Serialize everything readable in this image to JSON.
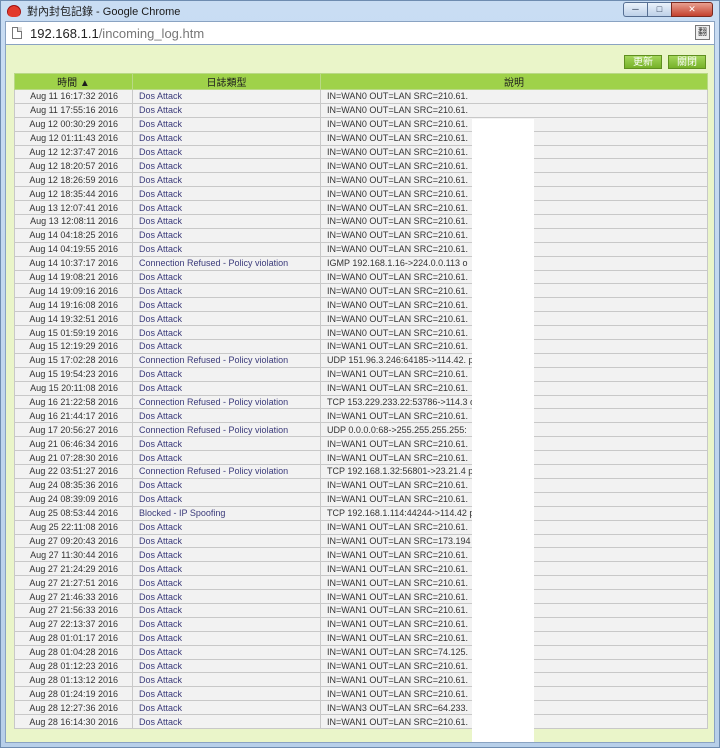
{
  "window": {
    "title": "對內封包記錄 - Google Chrome",
    "min_label": "─",
    "max_label": "□",
    "close_label": "✕"
  },
  "address": {
    "host": "192.168.1.1",
    "path": "/incoming_log.htm",
    "translate_label": "翻"
  },
  "toolbar": {
    "refresh_label": "更新",
    "close_label": "關閉"
  },
  "table": {
    "headers": {
      "time": "時間 ▲",
      "type": "日誌類型",
      "desc": "說明"
    },
    "rows": [
      {
        "time": "Aug 11 16:17:32 2016",
        "type": "Dos Attack",
        "desc": "IN=WAN0 OUT=LAN SRC=210.61."
      },
      {
        "time": "Aug 11 17:55:16 2016",
        "type": "Dos Attack",
        "desc": "IN=WAN0 OUT=LAN SRC=210.61."
      },
      {
        "time": "Aug 12 00:30:29 2016",
        "type": "Dos Attack",
        "desc": "IN=WAN0 OUT=LAN SRC=210.61."
      },
      {
        "time": "Aug 12 01:11:43 2016",
        "type": "Dos Attack",
        "desc": "IN=WAN0 OUT=LAN SRC=210.61."
      },
      {
        "time": "Aug 12 12:37:47 2016",
        "type": "Dos Attack",
        "desc": "IN=WAN0 OUT=LAN SRC=210.61."
      },
      {
        "time": "Aug 12 18:20:57 2016",
        "type": "Dos Attack",
        "desc": "IN=WAN0 OUT=LAN SRC=210.61."
      },
      {
        "time": "Aug 12 18:26:59 2016",
        "type": "Dos Attack",
        "desc": "IN=WAN0 OUT=LAN SRC=210.61."
      },
      {
        "time": "Aug 12 18:35:44 2016",
        "type": "Dos Attack",
        "desc": "IN=WAN0 OUT=LAN SRC=210.61."
      },
      {
        "time": "Aug 13 12:07:41 2016",
        "type": "Dos Attack",
        "desc": "IN=WAN0 OUT=LAN SRC=210.61."
      },
      {
        "time": "Aug 13 12:08:11 2016",
        "type": "Dos Attack",
        "desc": "IN=WAN0 OUT=LAN SRC=210.61."
      },
      {
        "time": "Aug 14 04:18:25 2016",
        "type": "Dos Attack",
        "desc": "IN=WAN0 OUT=LAN SRC=210.61."
      },
      {
        "time": "Aug 14 04:19:55 2016",
        "type": "Dos Attack",
        "desc": "IN=WAN0 OUT=LAN SRC=210.61."
      },
      {
        "time": "Aug 14 10:37:17 2016",
        "type": "Connection Refused - Policy violation",
        "desc": "IGMP 192.168.1.16->224.0.0.113 o"
      },
      {
        "time": "Aug 14 19:08:21 2016",
        "type": "Dos Attack",
        "desc": "IN=WAN0 OUT=LAN SRC=210.61."
      },
      {
        "time": "Aug 14 19:09:16 2016",
        "type": "Dos Attack",
        "desc": "IN=WAN0 OUT=LAN SRC=210.61."
      },
      {
        "time": "Aug 14 19:16:08 2016",
        "type": "Dos Attack",
        "desc": "IN=WAN0 OUT=LAN SRC=210.61."
      },
      {
        "time": "Aug 14 19:32:51 2016",
        "type": "Dos Attack",
        "desc": "IN=WAN0 OUT=LAN SRC=210.61."
      },
      {
        "time": "Aug 15 01:59:19 2016",
        "type": "Dos Attack",
        "desc": "IN=WAN0 OUT=LAN SRC=210.61."
      },
      {
        "time": "Aug 15 12:19:29 2016",
        "type": "Dos Attack",
        "desc": "IN=WAN1 OUT=LAN SRC=210.61."
      },
      {
        "time": "Aug 15 17:02:28 2016",
        "type": "Connection Refused - Policy violation",
        "desc": "UDP 151.96.3.246:64185->114.42.                ppp3"
      },
      {
        "time": "Aug 15 19:54:23 2016",
        "type": "Dos Attack",
        "desc": "IN=WAN1 OUT=LAN SRC=210.61."
      },
      {
        "time": "Aug 15 20:11:08 2016",
        "type": "Dos Attack",
        "desc": "IN=WAN1 OUT=LAN SRC=210.61."
      },
      {
        "time": "Aug 16 21:22:58 2016",
        "type": "Connection Refused - Policy violation",
        "desc": "TCP 153.229.233.22:53786->114.3              on ppp3"
      },
      {
        "time": "Aug 16 21:44:17 2016",
        "type": "Dos Attack",
        "desc": "IN=WAN1 OUT=LAN SRC=210.61."
      },
      {
        "time": "Aug 17 20:56:27 2016",
        "type": "Connection Refused - Policy violation",
        "desc": "UDP 0.0.0.0:68->255.255.255.255:"
      },
      {
        "time": "Aug 21 06:46:34 2016",
        "type": "Dos Attack",
        "desc": "IN=WAN1 OUT=LAN SRC=210.61."
      },
      {
        "time": "Aug 21 07:28:30 2016",
        "type": "Dos Attack",
        "desc": "IN=WAN1 OUT=LAN SRC=210.61."
      },
      {
        "time": "Aug 22 03:51:27 2016",
        "type": "Connection Refused - Policy violation",
        "desc": "TCP 192.168.1.32:56801->23.21.4               p0"
      },
      {
        "time": "Aug 24 08:35:36 2016",
        "type": "Dos Attack",
        "desc": "IN=WAN1 OUT=LAN SRC=210.61."
      },
      {
        "time": "Aug 24 08:39:09 2016",
        "type": "Dos Attack",
        "desc": "IN=WAN1 OUT=LAN SRC=210.61."
      },
      {
        "time": "Aug 25 08:53:44 2016",
        "type": "Blocked - IP Spoofing",
        "desc": "TCP 192.168.1.114:44244->114.42                ppp0"
      },
      {
        "time": "Aug 25 22:11:08 2016",
        "type": "Dos Attack",
        "desc": "IN=WAN1 OUT=LAN SRC=210.61."
      },
      {
        "time": "Aug 27 09:20:43 2016",
        "type": "Dos Attack",
        "desc": "IN=WAN1 OUT=LAN SRC=173.194"
      },
      {
        "time": "Aug 27 11:30:44 2016",
        "type": "Dos Attack",
        "desc": "IN=WAN1 OUT=LAN SRC=210.61."
      },
      {
        "time": "Aug 27 21:24:29 2016",
        "type": "Dos Attack",
        "desc": "IN=WAN1 OUT=LAN SRC=210.61."
      },
      {
        "time": "Aug 27 21:27:51 2016",
        "type": "Dos Attack",
        "desc": "IN=WAN1 OUT=LAN SRC=210.61."
      },
      {
        "time": "Aug 27 21:46:33 2016",
        "type": "Dos Attack",
        "desc": "IN=WAN1 OUT=LAN SRC=210.61."
      },
      {
        "time": "Aug 27 21:56:33 2016",
        "type": "Dos Attack",
        "desc": "IN=WAN1 OUT=LAN SRC=210.61."
      },
      {
        "time": "Aug 27 22:13:37 2016",
        "type": "Dos Attack",
        "desc": "IN=WAN1 OUT=LAN SRC=210.61."
      },
      {
        "time": "Aug 28 01:01:17 2016",
        "type": "Dos Attack",
        "desc": "IN=WAN1 OUT=LAN SRC=210.61."
      },
      {
        "time": "Aug 28 01:04:28 2016",
        "type": "Dos Attack",
        "desc": "IN=WAN1 OUT=LAN SRC=74.125."
      },
      {
        "time": "Aug 28 01:12:23 2016",
        "type": "Dos Attack",
        "desc": "IN=WAN1 OUT=LAN SRC=210.61."
      },
      {
        "time": "Aug 28 01:13:12 2016",
        "type": "Dos Attack",
        "desc": "IN=WAN1 OUT=LAN SRC=210.61."
      },
      {
        "time": "Aug 28 01:24:19 2016",
        "type": "Dos Attack",
        "desc": "IN=WAN1 OUT=LAN SRC=210.61."
      },
      {
        "time": "Aug 28 12:27:36 2016",
        "type": "Dos Attack",
        "desc": "IN=WAN3 OUT=LAN SRC=64.233."
      },
      {
        "time": "Aug 28 16:14:30 2016",
        "type": "Dos Attack",
        "desc": "IN=WAN1 OUT=LAN SRC=210.61."
      }
    ]
  }
}
